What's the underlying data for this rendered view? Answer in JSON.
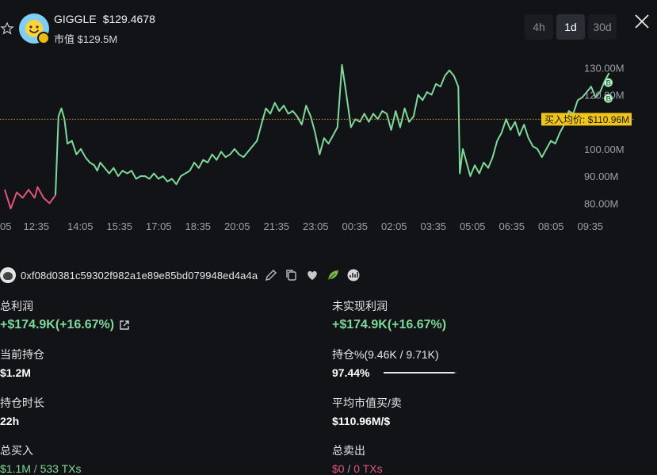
{
  "token": {
    "symbol": "GIGGLE",
    "price": "$129.4678",
    "market_cap_label": "市值",
    "market_cap": "$129.5M"
  },
  "timeframes": [
    {
      "label": "4h",
      "active": false
    },
    {
      "label": "1d",
      "active": true
    },
    {
      "label": "30d",
      "active": false
    }
  ],
  "colors": {
    "up": "#7fd99a",
    "down": "#e0557a",
    "avg_line": "#d4a017",
    "avg_label_bg": "#f0c419"
  },
  "chart_data": {
    "type": "line",
    "y_unit": "M",
    "ylim": [
      76,
      133
    ],
    "ytick_labels": [
      "130.00M",
      "120.00M",
      "110.00M",
      "100.00M",
      "90.00M",
      "80.00M"
    ],
    "yticks_visible": [
      130,
      120,
      100,
      90,
      80
    ],
    "xtick_labels": [
      "05",
      "12:35",
      "14:05",
      "15:35",
      "17:05",
      "18:35",
      "20:05",
      "21:35",
      "23:05",
      "00:35",
      "02:05",
      "03:35",
      "05:05",
      "06:35",
      "08:05",
      "09:35"
    ],
    "avg_buy": {
      "label": "买入均价: $110.96M",
      "value": 110.96
    },
    "markers": [
      "B",
      "B"
    ],
    "grid": false,
    "series": [
      {
        "color": "down",
        "points": [
          [
            0.0,
            85
          ],
          [
            0.4,
            78
          ],
          [
            0.8,
            84
          ],
          [
            1.2,
            82
          ],
          [
            1.6,
            85
          ],
          [
            2.0,
            82
          ],
          [
            2.2,
            86
          ],
          [
            2.6,
            82
          ],
          [
            3.0,
            80
          ],
          [
            3.4,
            83
          ]
        ]
      },
      {
        "color": "up",
        "points": [
          [
            3.4,
            83
          ],
          [
            3.6,
            112
          ],
          [
            3.8,
            115
          ],
          [
            4.0,
            111
          ],
          [
            4.2,
            102
          ],
          [
            4.5,
            103
          ],
          [
            4.8,
            98
          ],
          [
            5.1,
            100
          ],
          [
            5.4,
            97
          ],
          [
            5.7,
            95
          ],
          [
            6.0,
            94
          ],
          [
            6.2,
            92
          ],
          [
            6.4,
            95
          ],
          [
            6.7,
            93
          ],
          [
            7.0,
            91
          ],
          [
            7.3,
            93
          ],
          [
            7.6,
            90
          ],
          [
            7.9,
            92
          ],
          [
            8.2,
            91
          ],
          [
            8.5,
            92
          ],
          [
            8.8,
            89
          ],
          [
            9.1,
            90
          ],
          [
            9.4,
            90
          ],
          [
            9.7,
            89
          ],
          [
            10.0,
            91
          ],
          [
            10.3,
            89
          ],
          [
            10.6,
            90
          ],
          [
            10.9,
            88
          ],
          [
            11.2,
            89
          ],
          [
            11.5,
            87
          ],
          [
            11.8,
            90
          ],
          [
            12.1,
            91
          ],
          [
            12.4,
            92
          ],
          [
            12.7,
            95
          ],
          [
            13.0,
            93
          ],
          [
            13.3,
            96
          ],
          [
            13.6,
            95
          ],
          [
            13.9,
            98
          ],
          [
            14.2,
            96
          ],
          [
            14.5,
            99
          ],
          [
            14.8,
            97
          ],
          [
            15.1,
            98
          ],
          [
            15.4,
            100
          ],
          [
            15.7,
            98
          ],
          [
            16.0,
            97
          ],
          [
            16.3,
            99
          ],
          [
            16.6,
            101
          ],
          [
            16.9,
            103
          ],
          [
            17.2,
            109
          ],
          [
            17.5,
            115
          ],
          [
            17.8,
            113
          ],
          [
            18.1,
            117
          ],
          [
            18.4,
            114
          ],
          [
            18.7,
            116
          ],
          [
            19.0,
            113
          ],
          [
            19.3,
            114
          ],
          [
            19.6,
            112
          ],
          [
            19.9,
            109
          ],
          [
            20.2,
            116
          ],
          [
            20.5,
            112
          ],
          [
            20.8,
            106
          ],
          [
            21.1,
            98
          ],
          [
            21.4,
            104
          ],
          [
            21.7,
            102
          ],
          [
            22.0,
            105
          ],
          [
            22.3,
            108
          ],
          [
            22.6,
            131
          ],
          [
            22.9,
            120
          ],
          [
            23.2,
            108
          ],
          [
            23.5,
            111
          ],
          [
            23.8,
            110
          ],
          [
            24.1,
            113
          ],
          [
            24.4,
            110
          ],
          [
            24.7,
            113
          ],
          [
            25.0,
            111
          ],
          [
            25.3,
            114
          ],
          [
            25.6,
            113
          ],
          [
            25.9,
            107
          ],
          [
            26.2,
            114
          ],
          [
            26.5,
            108
          ],
          [
            26.8,
            115
          ],
          [
            27.1,
            110
          ],
          [
            27.4,
            112
          ],
          [
            27.7,
            120
          ],
          [
            28.0,
            118
          ],
          [
            28.3,
            121
          ],
          [
            28.6,
            120
          ],
          [
            28.9,
            124
          ],
          [
            29.2,
            123
          ],
          [
            29.5,
            127
          ],
          [
            29.8,
            129
          ],
          [
            30.1,
            127
          ],
          [
            30.4,
            123
          ],
          [
            30.5,
            91
          ],
          [
            30.7,
            100
          ],
          [
            30.9,
            96
          ],
          [
            31.2,
            90
          ],
          [
            31.5,
            94
          ],
          [
            31.8,
            91
          ],
          [
            32.1,
            95
          ],
          [
            32.4,
            93
          ],
          [
            32.7,
            97
          ],
          [
            33.0,
            103
          ],
          [
            33.3,
            106
          ],
          [
            33.6,
            111
          ],
          [
            33.9,
            107
          ],
          [
            34.2,
            110
          ],
          [
            34.5,
            105
          ],
          [
            34.8,
            109
          ],
          [
            35.1,
            104
          ],
          [
            35.4,
            101
          ],
          [
            35.7,
            100
          ],
          [
            36.0,
            97
          ],
          [
            36.3,
            100
          ],
          [
            36.6,
            103
          ],
          [
            36.9,
            102
          ],
          [
            37.2,
            106
          ],
          [
            37.5,
            109
          ],
          [
            37.8,
            114
          ],
          [
            38.1,
            113
          ],
          [
            38.4,
            118
          ],
          [
            38.7,
            119
          ],
          [
            39.0,
            121
          ],
          [
            39.3,
            123
          ],
          [
            39.6,
            119
          ],
          [
            39.9,
            121
          ],
          [
            40.2,
            125
          ],
          [
            40.5,
            128
          ]
        ]
      }
    ]
  },
  "wallet": {
    "address": "0xf08d0381c59302f982a1e89e85bd079948ed4a4a"
  },
  "stats": {
    "total_profit": {
      "label": "总利润",
      "value": "+$174.9K(+16.67%)"
    },
    "unrealized_profit": {
      "label": "未实现利润",
      "value": "+$174.9K(+16.67%)"
    },
    "current_position": {
      "label": "当前持仓",
      "value": "$1.2M"
    },
    "holding_pct": {
      "label": "持仓%(9.46K / 9.71K)",
      "value": "97.44%",
      "fraction": 0.9744
    },
    "holding_duration": {
      "label": "持仓时长",
      "value": "22h"
    },
    "avg_mcap": {
      "label": "平均市值买/卖",
      "value": "$110.96M/$"
    },
    "total_buy": {
      "label": "总买入",
      "amount": "$1.1M",
      "sep": " / ",
      "txs": "533 TXs"
    },
    "total_sell": {
      "label": "总卖出",
      "amount": "$0",
      "sep": " / ",
      "txs": "0 TXs"
    }
  }
}
